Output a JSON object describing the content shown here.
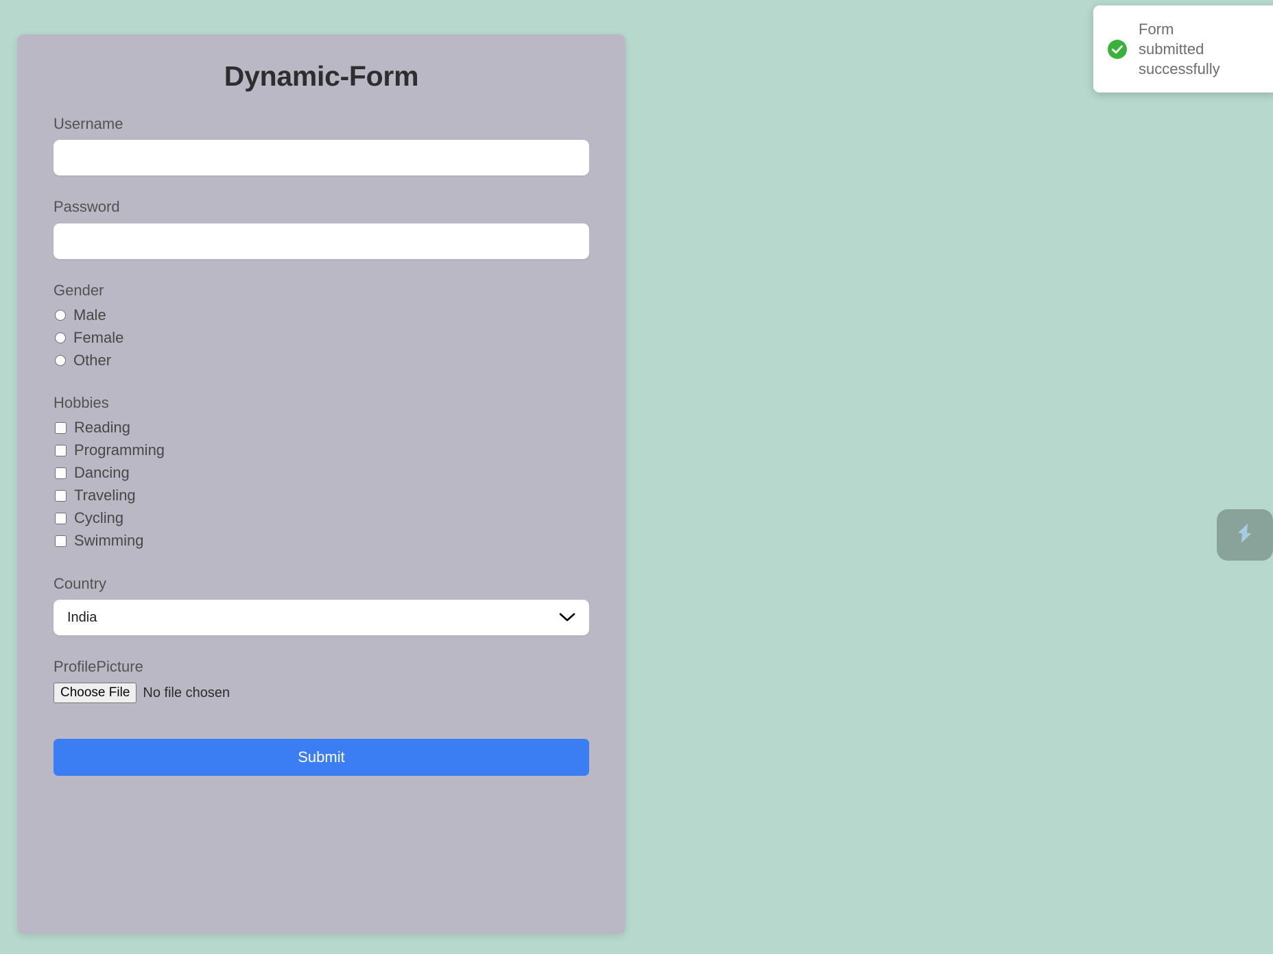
{
  "page": {
    "background_color": "#b6d8cd"
  },
  "form": {
    "title": "Dynamic-Form",
    "card_color": "#bbb8c6",
    "username": {
      "label": "Username",
      "value": "",
      "placeholder": ""
    },
    "password": {
      "label": "Password",
      "value": "",
      "placeholder": ""
    },
    "gender": {
      "label": "Gender",
      "options": [
        {
          "label": "Male",
          "checked": false
        },
        {
          "label": "Female",
          "checked": false
        },
        {
          "label": "Other",
          "checked": false
        }
      ]
    },
    "hobbies": {
      "label": "Hobbies",
      "options": [
        {
          "label": "Reading",
          "checked": false
        },
        {
          "label": "Programming",
          "checked": false
        },
        {
          "label": "Dancing",
          "checked": false
        },
        {
          "label": "Traveling",
          "checked": false
        },
        {
          "label": "Cycling",
          "checked": false
        },
        {
          "label": "Swimming",
          "checked": false
        }
      ]
    },
    "country": {
      "label": "Country",
      "selected": "India",
      "icon": "chevron-down-icon"
    },
    "profile_picture": {
      "label": "ProfilePicture",
      "button_label": "Choose File",
      "status": "No file chosen"
    },
    "submit": {
      "label": "Submit",
      "color": "#3b7ef4"
    }
  },
  "toast": {
    "message": "Form submitted successfully",
    "icon": "check-circle-icon",
    "icon_color": "#3ab13a"
  },
  "side_widget": {
    "icon": "lightning-s-icon",
    "icon_color": "#a8cfe4"
  }
}
